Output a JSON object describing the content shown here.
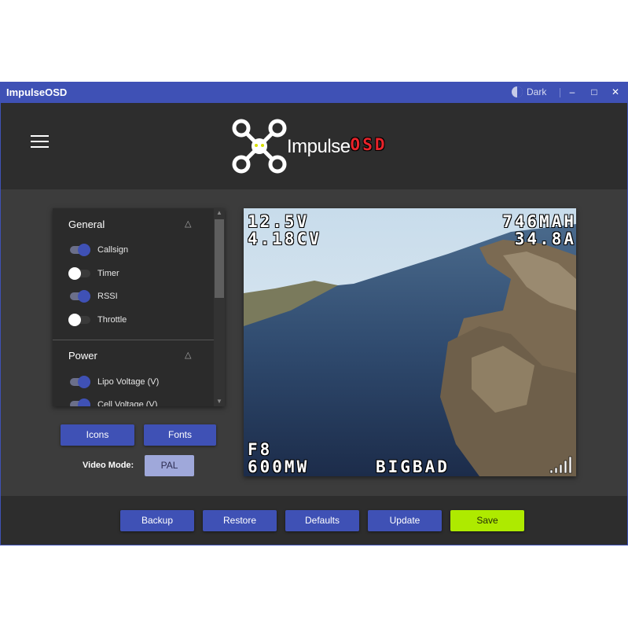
{
  "window": {
    "title": "ImpulseOSD",
    "theme_label": "Dark",
    "minimize": "–",
    "maximize": "□",
    "close": "✕"
  },
  "header": {
    "logo_text_main": "Impulse",
    "logo_text_accent": "OSD"
  },
  "panel": {
    "sections": [
      {
        "title": "General",
        "items": [
          {
            "label": "Callsign",
            "on": true
          },
          {
            "label": "Timer",
            "on": false
          },
          {
            "label": "RSSI",
            "on": true
          },
          {
            "label": "Throttle",
            "on": false
          }
        ]
      },
      {
        "title": "Power",
        "items": [
          {
            "label": "Lipo Voltage (V)",
            "on": true
          },
          {
            "label": "Cell Voltage (V)",
            "on": true
          }
        ]
      }
    ]
  },
  "buttons": {
    "icons": "Icons",
    "fonts": "Fonts",
    "video_mode_label": "Video Mode:",
    "video_mode_value": "PAL"
  },
  "osd": {
    "voltage": "12.5V",
    "cell_voltage": "4.18CV",
    "mah": "746MAH",
    "current": "34.8A",
    "channel": "F8",
    "power": "600MW",
    "callsign": "BIGBAD"
  },
  "footer": {
    "backup": "Backup",
    "restore": "Restore",
    "defaults": "Defaults",
    "update": "Update",
    "save": "Save"
  },
  "colors": {
    "primary": "#3f51b5",
    "save": "#aeea00",
    "accent_red": "#e8232a"
  }
}
